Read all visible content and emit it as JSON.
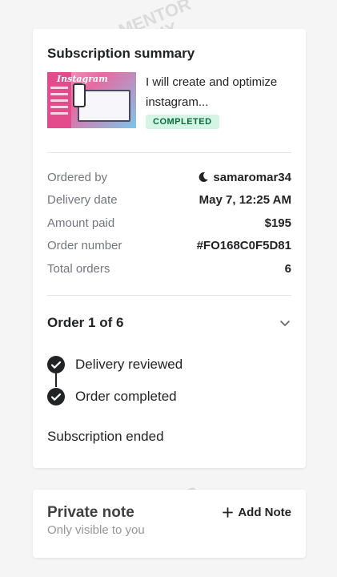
{
  "summary": {
    "title": "Subscription summary",
    "gig": {
      "title": "I will create and optimize instagram...",
      "thumbnail_text": "Instagram",
      "status": "COMPLETED"
    },
    "details": [
      {
        "label": "Ordered by",
        "value": "samaromar34",
        "icon": "moon-icon"
      },
      {
        "label": "Delivery date",
        "value": "May 7, 12:25 AM"
      },
      {
        "label": "Amount paid",
        "value": "$195"
      },
      {
        "label": "Order number",
        "value": "#FO168C0F5D81"
      },
      {
        "label": "Total orders",
        "value": "6"
      }
    ],
    "order": {
      "title": "Order 1 of 6",
      "timeline": [
        {
          "label": "Delivery reviewed",
          "icon": "check-icon"
        },
        {
          "label": "Order completed",
          "icon": "check-icon"
        }
      ],
      "footer": "Subscription ended"
    }
  },
  "note": {
    "title": "Private note",
    "subtitle": "Only visible to you",
    "add_label": "Add Note"
  },
  "watermark": {
    "line1": "MENTOR",
    "line2": "GENIX"
  },
  "colors": {
    "badge_bg": "#d5f5e4",
    "badge_text": "#0a6b3b",
    "text": "#222325",
    "muted": "#74767e"
  }
}
